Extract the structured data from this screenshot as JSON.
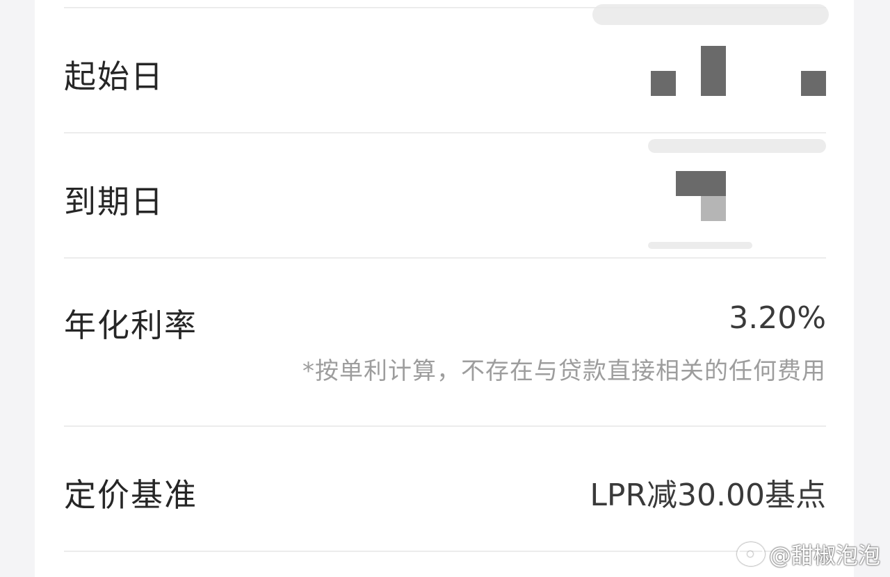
{
  "rows": [
    {
      "label": "起始日",
      "value": ""
    },
    {
      "label": "到期日",
      "value": ""
    },
    {
      "label": "年化利率",
      "value": "3.20%",
      "note": "*按单利计算，不存在与贷款直接相关的任何费用"
    },
    {
      "label": "定价基准",
      "value": "LPR减30.00基点"
    }
  ],
  "watermark": {
    "text": "@甜椒泡泡",
    "icon": "weibo-icon"
  },
  "colors": {
    "background": "#f4f4f6",
    "card": "#ffffff",
    "label": "#262626",
    "note": "#9d9d9d",
    "mosaic": "#6a6a6a"
  }
}
